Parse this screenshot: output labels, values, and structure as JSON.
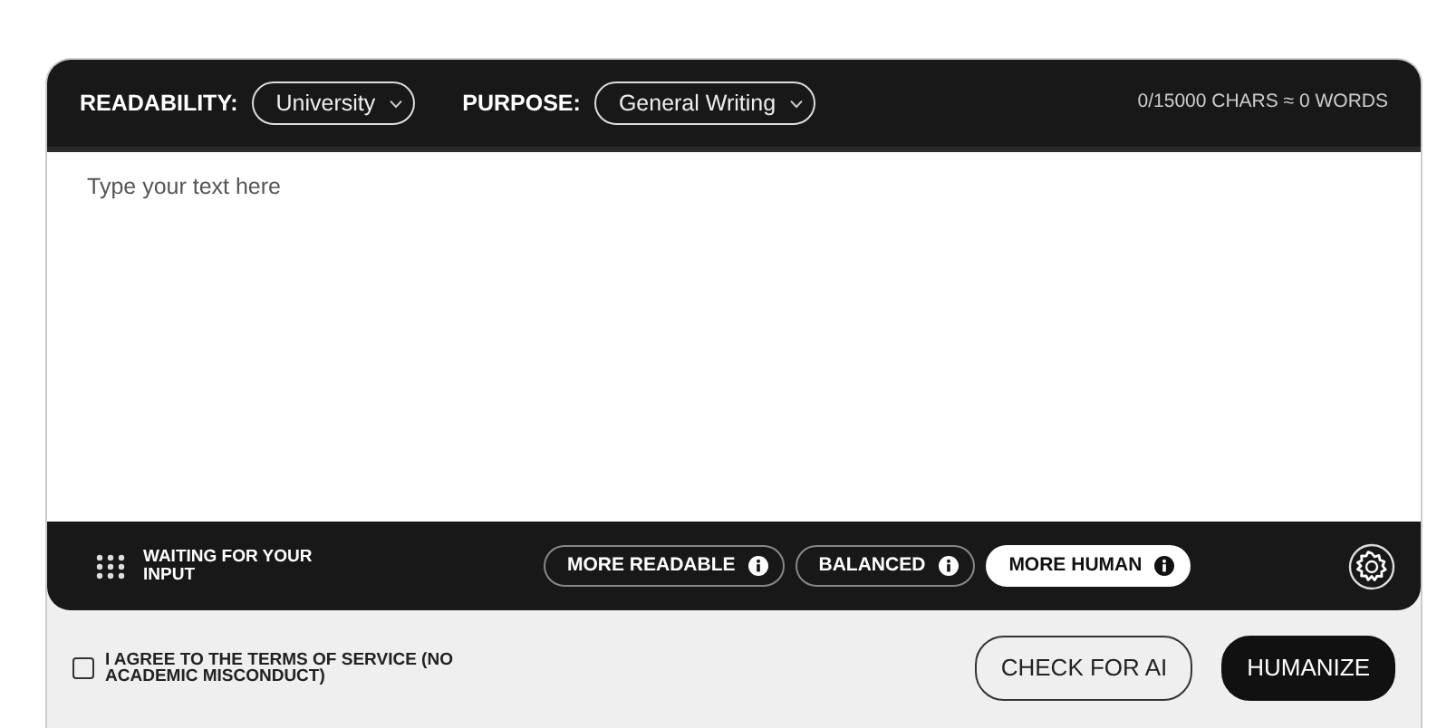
{
  "header": {
    "selects": [
      {
        "label": "READABILITY:",
        "value": "University"
      },
      {
        "label": "PURPOSE:",
        "value": "General Writing"
      }
    ],
    "counter": "0/15000 CHARS ≈ 0 WORDS"
  },
  "editor": {
    "placeholder": "Type your text here"
  },
  "footer": {
    "status": "WAITING FOR YOUR INPUT",
    "modes": [
      {
        "label": "MORE READABLE",
        "selected": false
      },
      {
        "label": "BALANCED",
        "selected": false
      },
      {
        "label": "MORE HUMAN",
        "selected": true
      }
    ]
  },
  "actions": {
    "agree": {
      "label": "I AGREE TO THE TERMS OF SERVICE (NO ACADEMIC MISCONDUCT)",
      "checked": false
    },
    "buttons": [
      {
        "label": "CHECK FOR AI",
        "kind": "outline"
      },
      {
        "label": "HUMANIZE",
        "kind": "solid"
      }
    ]
  }
}
